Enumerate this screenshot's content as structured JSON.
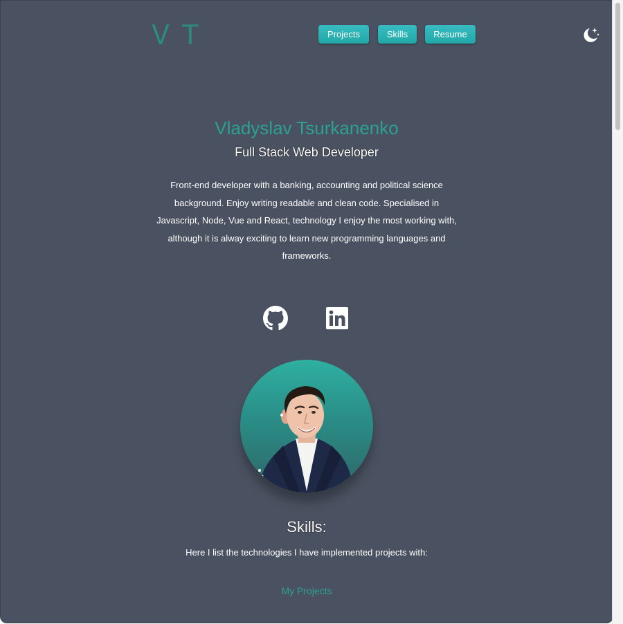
{
  "logo": {
    "letter1": "V",
    "letter2": "T"
  },
  "nav": {
    "items": [
      {
        "label": "Projects"
      },
      {
        "label": "Skills"
      },
      {
        "label": "Resume"
      }
    ]
  },
  "theme_toggle": {
    "icon": "moon-stars-icon"
  },
  "hero": {
    "name": "Vladyslav Tsurkanenko",
    "title": "Full Stack Web Developer",
    "bio": "Front-end developer with a banking, accounting and political science background. Enjoy writing readable and clean code. Specialised in Javascript, Node, Vue and React, technology I enjoy the most working with, although it is alway exciting to learn new programming languages and frameworks."
  },
  "social": {
    "icons": [
      "github-icon",
      "linkedin-icon"
    ]
  },
  "skills": {
    "heading": "Skills:",
    "subtitle": "Here I list the technologies I have implemented projects with:"
  },
  "projects_link": "My Projects",
  "colors": {
    "background": "#4a5261",
    "accent": "#2ba191",
    "button": "#2eb3b7"
  }
}
